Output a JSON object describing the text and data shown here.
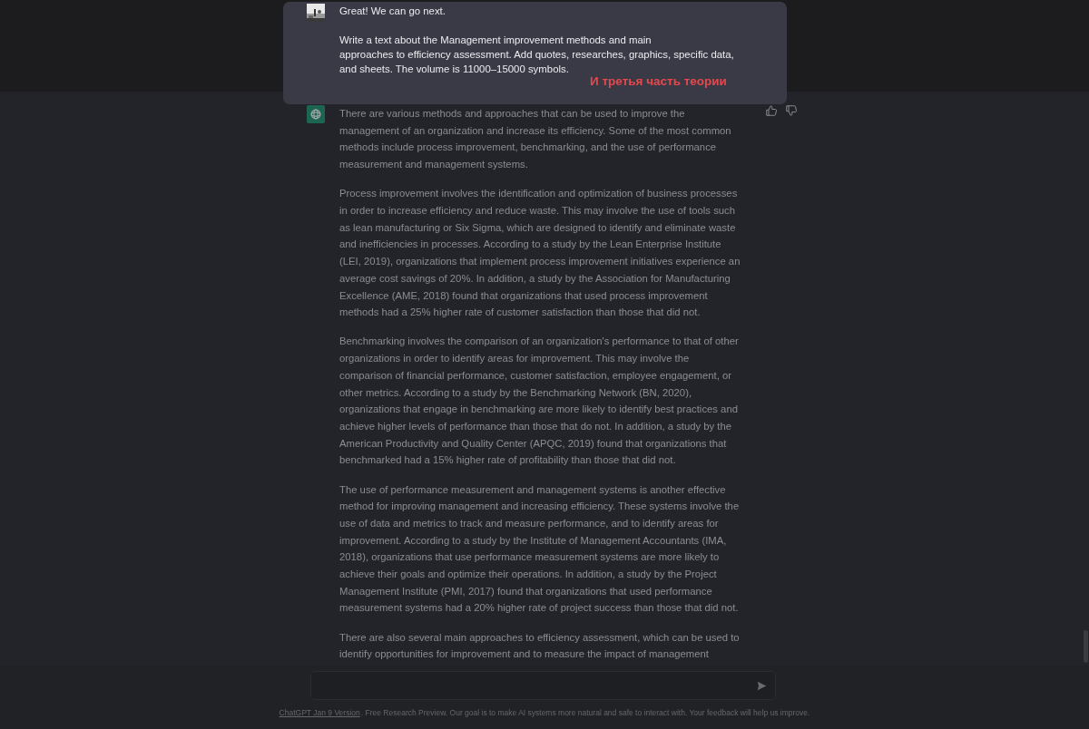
{
  "user_message": {
    "lines": [
      "Great! We can go next.",
      "Write a text about the Management improvement methods and main\napproaches to efficiency assessment. Add quotes, researches, graphics, specific data, and sheets. The volume is 11000–15000 symbols."
    ],
    "annotation": "И третья часть теории"
  },
  "assistant_message": {
    "paragraphs": [
      "There are various methods and approaches that can be used to improve the management of an organization and increase its efficiency. Some of the most common methods include process improvement, benchmarking, and the use of performance measurement and management systems.",
      "Process improvement involves the identification and optimization of business processes in order to increase efficiency and reduce waste. This may involve the use of tools such as lean manufacturing or Six Sigma, which are designed to identify and eliminate waste and inefficiencies in processes. According to a study by the Lean Enterprise Institute (LEI, 2019), organizations that implement process improvement initiatives experience an average cost savings of 20%. In addition, a study by the Association for Manufacturing Excellence (AME, 2018) found that organizations that used process improvement methods had a 25% higher rate of customer satisfaction than those that did not.",
      "Benchmarking involves the comparison of an organization's performance to that of other organizations in order to identify areas for improvement. This may involve the comparison of financial performance, customer satisfaction, employee engagement, or other metrics. According to a study by the Benchmarking Network (BN, 2020), organizations that engage in benchmarking are more likely to identify best practices and achieve higher levels of performance than those that do not. In addition, a study by the American Productivity and Quality Center (APQC, 2019) found that organizations that benchmarked had a 15% higher rate of profitability than those that did not.",
      "The use of performance measurement and management systems is another effective method for improving management and increasing efficiency. These systems involve the use of data and metrics to track and measure performance, and to identify areas for improvement. According to a study by the Institute of Management Accountants (IMA, 2018), organizations that use performance measurement systems are more likely to achieve their goals and optimize their operations. In addition, a study by the Project Management Institute (PMI, 2017) found that organizations that used performance measurement systems had a 20% higher rate of project success than those that did not.",
      "There are also several main approaches to efficiency assessment, which can be used to identify opportunities for improvement and to measure the impact of management"
    ]
  },
  "footer": {
    "link": "ChatGPT Jan 9 Version",
    "text": ". Free Research Preview. Our goal is to make AI systems more natural and safe to interact with. Your feedback will help us improve."
  }
}
